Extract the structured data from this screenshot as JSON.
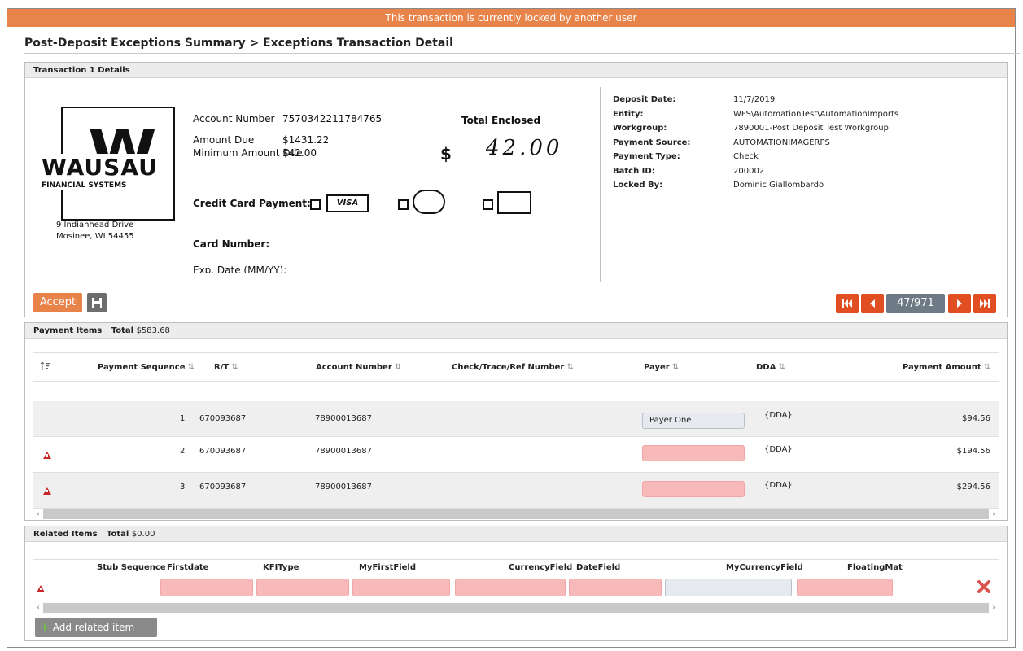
{
  "banner": "This transaction is currently locked by another user",
  "page_title": "Post-Deposit Exceptions Summary > Exceptions Transaction Detail",
  "transaction": {
    "panel_title": "Transaction 1 Details",
    "check": {
      "logo_letter": "W",
      "logo_name": "WAUSAU",
      "logo_sub": "FINANCIAL SYSTEMS",
      "address_line1": "9 Indianhead Drive",
      "address_line2": "Mosinee, WI 54455",
      "account_number_label": "Account Number",
      "account_number_value": "7570342211784765",
      "amount_due_label": "Amount Due",
      "amount_due_value": "$1431.22",
      "min_amount_label": "Minimum Amount Due",
      "min_amount_value": "$42.00",
      "total_enclosed_label": "Total Enclosed",
      "dollar_sign": "$",
      "handwritten_amount": "42.00",
      "credit_card_label": "Credit Card Payment:",
      "card_visa": "VISA",
      "card_number_label": "Card Number:",
      "exp_date_label": "Exp. Date (MM/YY):"
    },
    "meta": [
      {
        "key": "Deposit Date:",
        "value": "11/7/2019"
      },
      {
        "key": "Entity:",
        "value": "WFS\\AutomationTest\\AutomationImports"
      },
      {
        "key": "Workgroup:",
        "value": "7890001-Post Deposit Test Workgroup"
      },
      {
        "key": "Payment Source:",
        "value": "AUTOMATIONIMAGERPS"
      },
      {
        "key": "Payment Type:",
        "value": "Check"
      },
      {
        "key": "Batch ID:",
        "value": "200002"
      },
      {
        "key": "Locked By:",
        "value": "Dominic Giallombardo"
      }
    ],
    "accept_label": "Accept",
    "pager_count": "47/971"
  },
  "payment_items": {
    "title": "Payment Items",
    "total_label": "Total",
    "total_value": "$583.68",
    "columns": [
      "Payment Sequence",
      "R/T",
      "Account Number",
      "Check/Trace/Ref Number",
      "Payer",
      "DDA",
      "Payment Amount"
    ],
    "rows": [
      {
        "seq": "1",
        "rt": "670093687",
        "account": "78900013687",
        "check": "",
        "payer": "Payer One",
        "dda": "{DDA}",
        "amount": "$94.56",
        "error": false
      },
      {
        "seq": "2",
        "rt": "670093687",
        "account": "78900013687",
        "check": "",
        "payer": "",
        "dda": "{DDA}",
        "amount": "$194.56",
        "error": true
      },
      {
        "seq": "3",
        "rt": "670093687",
        "account": "78900013687",
        "check": "",
        "payer": "",
        "dda": "{DDA}",
        "amount": "$294.56",
        "error": true
      }
    ]
  },
  "related_items": {
    "title": "Related Items",
    "total_label": "Total",
    "total_value": "$0.00",
    "columns": [
      "Stub Sequence",
      "Firstdate",
      "KFIType",
      "MyFirstField",
      "CurrencyField",
      "DateField",
      "MyCurrencyField",
      "FloatingMat"
    ],
    "add_label": "Add related item"
  },
  "colors": {
    "banner": "#e8834a",
    "pager": "#e04e22",
    "error_field": "#f7b9b9",
    "warning": "#c62828",
    "delete": "#d9534f"
  },
  "icons": [
    "save-icon",
    "first-page-icon",
    "prev-page-icon",
    "next-page-icon",
    "last-page-icon",
    "sort-icon",
    "warning-icon",
    "delete-icon",
    "plus-icon"
  ]
}
